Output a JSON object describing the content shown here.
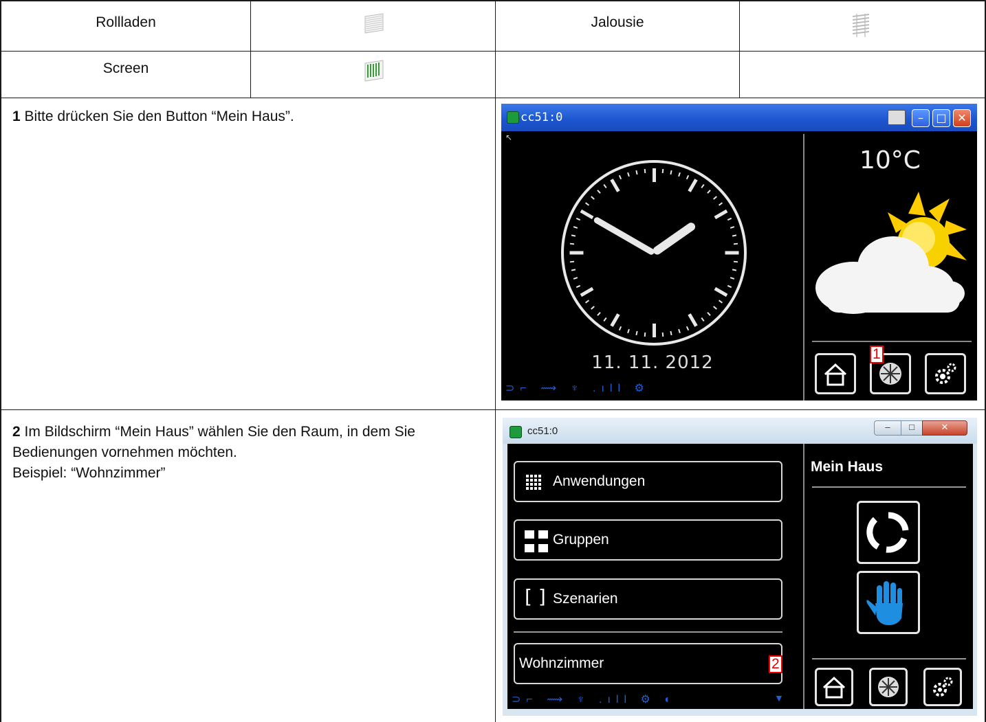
{
  "table": {
    "row1": {
      "c1": "Rollladen",
      "c3": "Jalousie"
    },
    "row2": {
      "c1": "Screen"
    }
  },
  "step1": {
    "num": "1",
    "text": "Bitte drücken Sie den Button “Mein Haus”."
  },
  "step2": {
    "num": "2",
    "line1": "Im Bildschirm “Mein Haus” wählen Sie den Raum, in dem Sie",
    "line2": "Bedienungen vornehmen möchten.",
    "line3": "Beispiel: “Wohnzimmer”"
  },
  "screen1": {
    "window_title": "cc51:0",
    "temperature": "10°C",
    "date": "11. 11. 2012",
    "marker": "1",
    "clock_time": "13:50",
    "weather_icon": "sun-cloud-icon"
  },
  "screen2": {
    "window_title": "cc51:0",
    "heading": "Mein Haus",
    "menu": [
      "Anwendungen",
      "Gruppen",
      "Szenarien"
    ],
    "room": "Wohnzimmer",
    "marker": "2"
  }
}
